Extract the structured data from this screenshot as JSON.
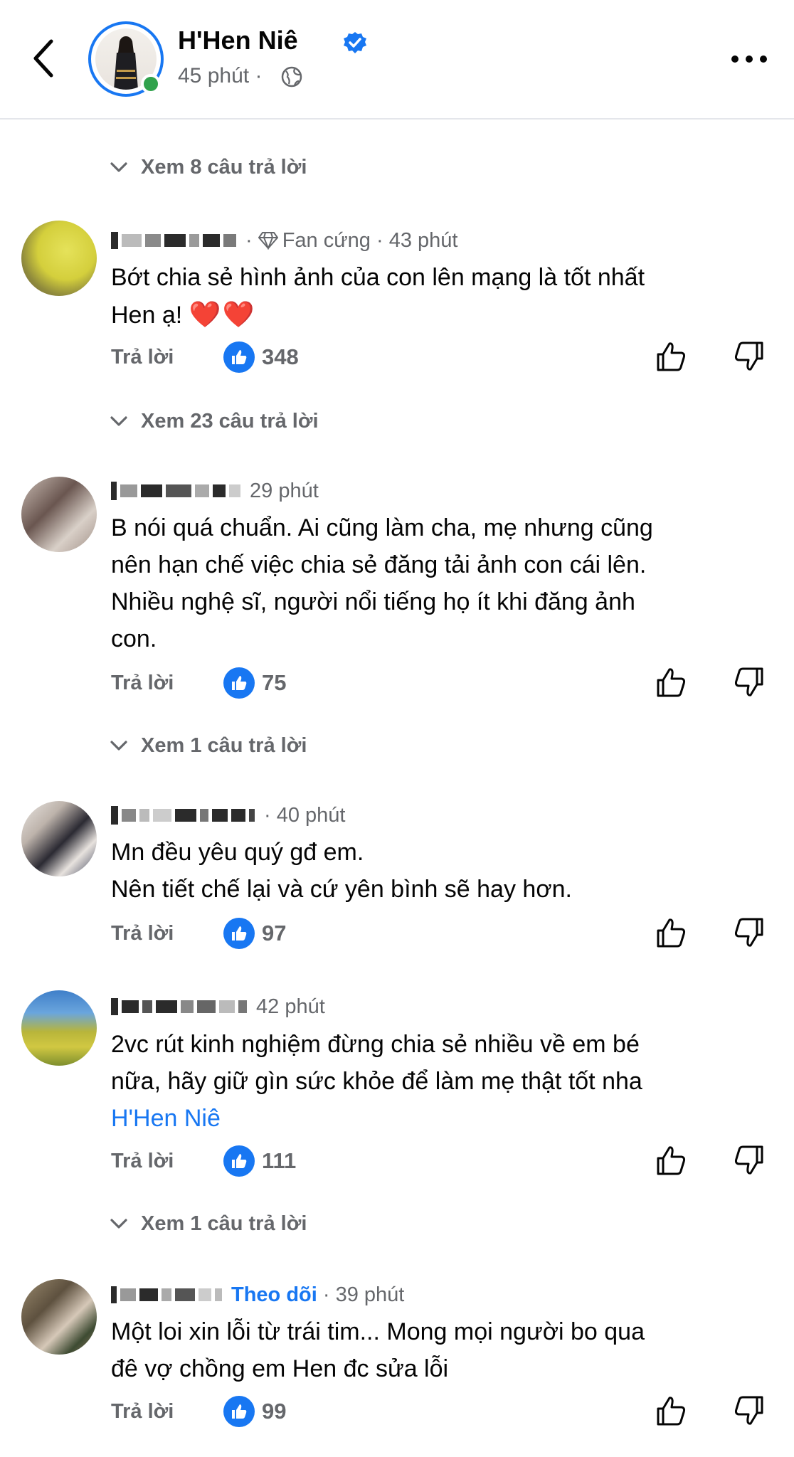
{
  "header": {
    "name": "H'Hen Niê",
    "time": "45 phút",
    "separator": "·"
  },
  "view_replies": [
    {
      "label": "Xem 8 câu trả lời"
    },
    {
      "label": "Xem 23 câu trả lời"
    },
    {
      "label": "Xem 1 câu trả lời"
    },
    {
      "label": "Xem 1 câu trả lời"
    }
  ],
  "comments": [
    {
      "badge": "Fan cứng",
      "time": "43 phút",
      "text_before": "Bớt chia sẻ hình ảnh của con lên mạng là tốt nhất\nHen ạ! ",
      "emoji": "❤️❤️",
      "reply": "Trả lời",
      "likes": "348"
    },
    {
      "time": "29 phút",
      "text": "B nói quá chuẩn. Ai cũng làm cha, mẹ nhưng cũng\nnên hạn chế việc chia sẻ đăng tải  ảnh con cái lên.\nNhiều nghệ sĩ, người nổi tiếng họ ít khi đăng ảnh\ncon.",
      "reply": "Trả lời",
      "likes": "75"
    },
    {
      "time": "40 phút",
      "text": "Mn đều yêu quý gđ em.\nNên tiết chế lại và cứ yên bình sẽ hay hơn.",
      "reply": "Trả lời",
      "likes": "97"
    },
    {
      "time": "42 phút",
      "text": "2vc rút kinh nghiệm đừng chia sẻ nhiều về em bé\nnữa, hãy giữ gìn sức khỏe để làm mẹ thật tốt nha",
      "mention": "H'Hen Niê",
      "reply": "Trả lời",
      "likes": "111"
    },
    {
      "follow": "Theo dõi",
      "time": "39 phút",
      "text": "Một loi xin lỗi từ trái tim... Mong mọi người bo qua\nđê vợ chồng em Hen đc sửa lỗi",
      "reply": "Trả lời",
      "likes": "99"
    }
  ],
  "icons": {
    "back": "chevron-left-icon",
    "verified": "verified-badge-icon",
    "globe": "globe-icon",
    "more": "more-icon",
    "chevron": "chevron-down-icon",
    "diamond": "diamond-icon",
    "like_badge": "like-badge-icon",
    "thumb_up": "thumbs-up-icon",
    "thumb_down": "thumbs-down-icon"
  },
  "colors": {
    "accent": "#1877f2",
    "online": "#31a24c",
    "secondary_text": "#65676b",
    "divider": "#e4e6eb"
  }
}
